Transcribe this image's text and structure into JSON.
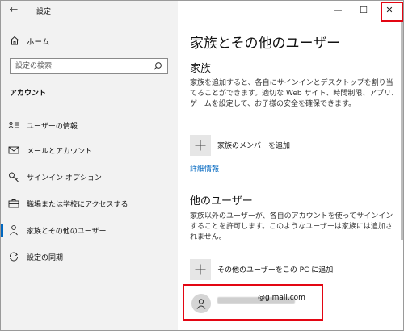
{
  "window": {
    "title": "設定",
    "back_glyph": "←",
    "controls": {
      "minimize": "—",
      "maximize": "☐",
      "close": "✕"
    }
  },
  "sidebar": {
    "home_label": "ホーム",
    "search_placeholder": "設定の検索",
    "section_heading": "アカウント",
    "items": [
      {
        "label": "ユーザーの情報",
        "icon": "user-card-icon"
      },
      {
        "label": "メールとアカウント",
        "icon": "mail-icon"
      },
      {
        "label": "サインイン オプション",
        "icon": "key-icon"
      },
      {
        "label": "職場または学校にアクセスする",
        "icon": "briefcase-icon"
      },
      {
        "label": "家族とその他のユーザー",
        "icon": "person-icon",
        "active": true
      },
      {
        "label": "設定の同期",
        "icon": "sync-icon"
      }
    ]
  },
  "main": {
    "title": "家族とその他のユーザー",
    "family": {
      "heading": "家族",
      "description": "家族を追加すると、各自にサインインとデスクトップを割り当てることができます。適切な Web サイト、時間制限、アプリ、ゲームを設定して、お子様の安全を確保できます。",
      "add_label": "家族のメンバーを追加",
      "details_link": "詳細情報"
    },
    "others": {
      "heading": "他のユーザー",
      "description": "家族以外のユーザーが、各自のアカウントを使ってサインインすることを許可します。このようなユーザーは家族には追加されません。",
      "add_label": "その他のユーザーをこの PC に追加",
      "user_email_suffix": "@g mail.com"
    }
  },
  "colors": {
    "accent": "#0067c0",
    "highlight": "#e30613",
    "sidebar_bg": "#f2f2f2"
  }
}
